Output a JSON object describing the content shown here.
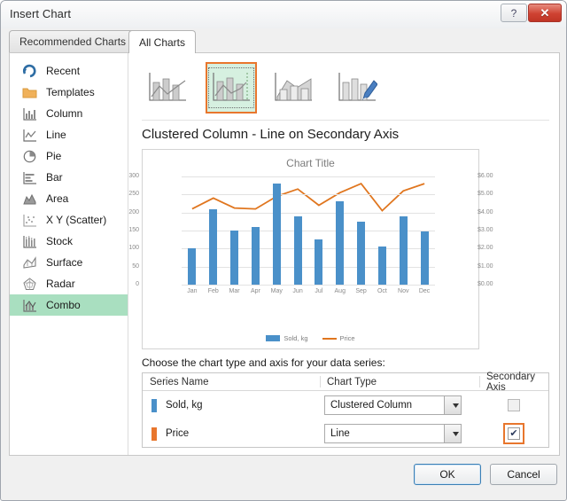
{
  "window": {
    "title": "Insert Chart",
    "help_label": "?",
    "close_label": "✕"
  },
  "tabs": [
    {
      "label": "Recommended Charts",
      "selected": false
    },
    {
      "label": "All Charts",
      "selected": true
    }
  ],
  "sidebar": {
    "items": [
      {
        "label": "Recent",
        "icon": "recent-icon",
        "selected": false
      },
      {
        "label": "Templates",
        "icon": "folder-icon",
        "selected": false
      },
      {
        "label": "Column",
        "icon": "column-icon",
        "selected": false
      },
      {
        "label": "Line",
        "icon": "line-icon",
        "selected": false
      },
      {
        "label": "Pie",
        "icon": "pie-icon",
        "selected": false
      },
      {
        "label": "Bar",
        "icon": "bar-icon",
        "selected": false
      },
      {
        "label": "Area",
        "icon": "area-icon",
        "selected": false
      },
      {
        "label": "X Y (Scatter)",
        "icon": "scatter-icon",
        "selected": false
      },
      {
        "label": "Stock",
        "icon": "stock-icon",
        "selected": false
      },
      {
        "label": "Surface",
        "icon": "surface-icon",
        "selected": false
      },
      {
        "label": "Radar",
        "icon": "radar-icon",
        "selected": false
      },
      {
        "label": "Combo",
        "icon": "combo-icon",
        "selected": true
      }
    ]
  },
  "thumbnails": [
    {
      "name": "clustered-column-line",
      "selected": false
    },
    {
      "name": "clustered-column-line-on-secondary-axis",
      "selected": true
    },
    {
      "name": "stacked-area-clustered-column",
      "selected": false
    },
    {
      "name": "custom-combination",
      "selected": false
    }
  ],
  "preview": {
    "heading": "Clustered Column - Line on Secondary Axis"
  },
  "chart_data": {
    "type": "bar",
    "title": "Chart Title",
    "categories": [
      "Jan",
      "Feb",
      "Mar",
      "Apr",
      "May",
      "Jun",
      "Jul",
      "Aug",
      "Sep",
      "Oct",
      "Nov",
      "Dec"
    ],
    "series": [
      {
        "name": "Sold, kg",
        "type": "bar",
        "axis": "primary",
        "color": "#4a90c9",
        "values": [
          100,
          210,
          150,
          160,
          280,
          190,
          125,
          230,
          175,
          105,
          190,
          148
        ]
      },
      {
        "name": "Price",
        "type": "line",
        "axis": "secondary",
        "color": "#e0761f",
        "values": [
          4.2,
          4.8,
          4.25,
          4.2,
          4.9,
          5.3,
          4.4,
          5.1,
          5.6,
          4.1,
          5.2,
          5.6
        ]
      }
    ],
    "yaxis": {
      "label": "",
      "ticks": [
        "0",
        "50",
        "100",
        "150",
        "200",
        "250",
        "300"
      ],
      "ylim": [
        0,
        300
      ]
    },
    "y2axis": {
      "label": "",
      "ticks": [
        "$0.00",
        "$1.00",
        "$2.00",
        "$3.00",
        "$4.00",
        "$5.00",
        "$6.00"
      ],
      "ylim": [
        0,
        6
      ]
    },
    "xlabel": "",
    "grid": true,
    "legend_position": "bottom",
    "legend": [
      "Sold, kg",
      "Price"
    ]
  },
  "series_section": {
    "instruction": "Choose the chart type and axis for your data series:",
    "columns": [
      "Series Name",
      "Chart Type",
      "Secondary Axis"
    ],
    "rows": [
      {
        "name": "Sold, kg",
        "swatch_color": "#4a90c9",
        "chart_type": "Clustered Column",
        "secondary_axis": false,
        "highlighted": false
      },
      {
        "name": "Price",
        "swatch_color": "#e8762d",
        "chart_type": "Line",
        "secondary_axis": true,
        "highlighted": true
      }
    ],
    "checked_glyph": "✔"
  },
  "footer": {
    "ok_label": "OK",
    "cancel_label": "Cancel"
  },
  "colors": {
    "accent_orange": "#e8762d",
    "series_blue": "#4a90c9",
    "series_orange": "#e0761f",
    "selection_green": "#a9dfc0"
  }
}
